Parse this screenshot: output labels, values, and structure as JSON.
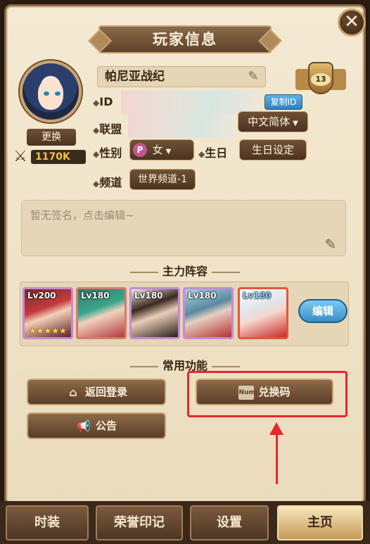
{
  "title": "玩家信息",
  "close_icon": "close-icon",
  "player": {
    "name": "帕尼亚战纪",
    "change_label": "更换",
    "power": "1170K",
    "rank_level": "13",
    "id_label": "ID",
    "copy_id_label": "复制ID",
    "league_label": "联盟",
    "language": "中文简体",
    "gender_label": "性别",
    "gender_value": "女",
    "gender_icon_text": "P",
    "birthday_label": "生日",
    "birthday_btn": "生日设定",
    "channel_label": "频道",
    "channel_value": "世界频道-1"
  },
  "signature_placeholder": "暂无签名，点击编辑~",
  "team": {
    "section_title": "主力阵容",
    "edit_label": "编辑",
    "heroes": [
      {
        "level": "Lv200",
        "stars": "★★★★★"
      },
      {
        "level": "Lv180",
        "stars": ""
      },
      {
        "level": "Lv180",
        "stars": ""
      },
      {
        "level": "Lv180",
        "stars": ""
      },
      {
        "level": "Lv180",
        "stars": ""
      }
    ]
  },
  "functions": {
    "section_title": "常用功能",
    "back_login": "返回登录",
    "redeem_code": "兑换码",
    "redeem_icon_text": "Num",
    "notice": "公告"
  },
  "tabs": [
    "时装",
    "荣誉印记",
    "设置",
    "主页"
  ],
  "active_tab": "主页",
  "colors": {
    "panel": "#efe2c6",
    "accent_brown": "#5e422b",
    "highlight_red": "#e8262b",
    "blue_btn": "#3a8ec6"
  }
}
